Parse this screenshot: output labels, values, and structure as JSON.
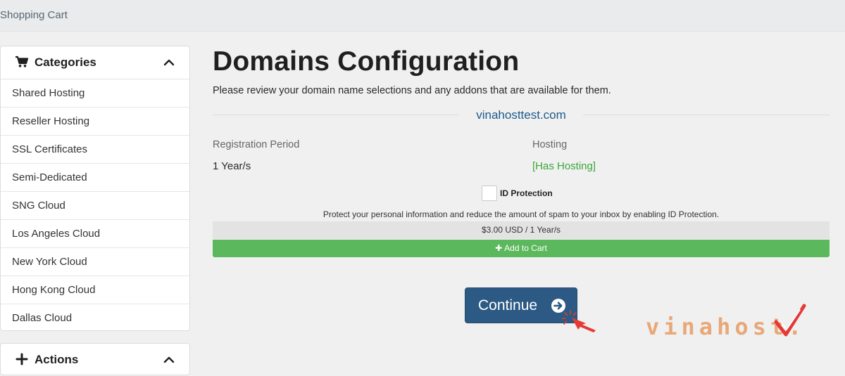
{
  "header": {
    "breadcrumb": "Shopping Cart"
  },
  "sidebar": {
    "categories_title": "Categories",
    "categories": [
      "Shared Hosting",
      "Reseller Hosting",
      "SSL Certificates",
      "Semi-Dedicated",
      "SNG Cloud",
      "Los Angeles Cloud",
      "New York Cloud",
      "Hong Kong Cloud",
      "Dallas Cloud"
    ],
    "actions_title": "Actions"
  },
  "main": {
    "title": "Domains Configuration",
    "intro": "Please review your domain name selections and any addons that are available for them.",
    "domain": "vinahosttest.com",
    "registration_label": "Registration Period",
    "registration_value": "1 Year/s",
    "hosting_label": "Hosting",
    "hosting_value": "[Has Hosting]",
    "id_protection_label": "ID Protection",
    "id_protection_desc": "Protect your personal information and reduce the amount of spam to your inbox by enabling ID Protection.",
    "price": "$3.00 USD / 1 Year/s",
    "add_to_cart": "Add to Cart",
    "continue_label": "Continue"
  },
  "watermark": {
    "logo_text": "vinahost."
  },
  "colors": {
    "continue_bg": "#2c5a84",
    "add_bg": "#5cb85c",
    "hosting_green": "#3aa83a",
    "domain_blue": "#1e5a8a",
    "logo_orange": "#e8a878",
    "logo_check": "#e53935",
    "cursor_red": "#e53935"
  },
  "icons": {
    "categories": "shopping-cart-icon",
    "categories_toggle": "chevron-up-icon",
    "actions": "plus-icon",
    "actions_toggle": "chevron-up-icon",
    "add": "plus-icon",
    "continue": "arrow-circle-right-icon",
    "pointer": "hand-pointer-icon"
  }
}
